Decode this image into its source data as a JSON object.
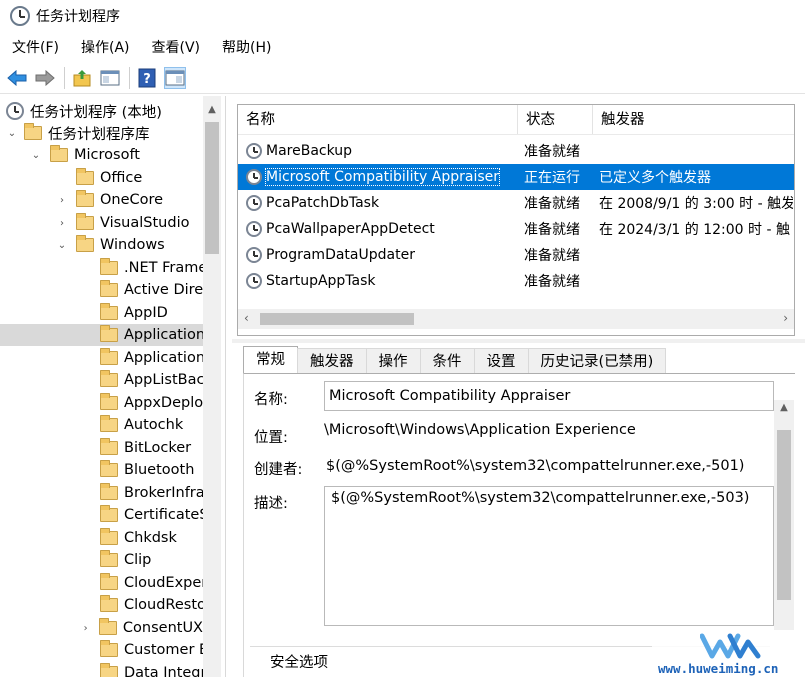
{
  "window": {
    "title": "任务计划程序"
  },
  "menu": [
    "文件(F)",
    "操作(A)",
    "查看(V)",
    "帮助(H)"
  ],
  "toolbar": {
    "icons": [
      "back-arrow-icon",
      "forward-arrow-icon",
      "up-folder-icon",
      "show-hide-tree-icon",
      "help-icon",
      "show-hide-action-pane-icon"
    ]
  },
  "tree": {
    "root": "任务计划程序 (本地)",
    "library": "任务计划程序库",
    "microsoft": "Microsoft",
    "ms_children": [
      "Office",
      "OneCore",
      "VisualStudio",
      "Windows"
    ],
    "windows_children": [
      ".NET Frame",
      "Active Dire",
      "AppID",
      "Application",
      "Application",
      "AppListBac",
      "AppxDeplo",
      "Autochk",
      "BitLocker",
      "Bluetooth",
      "BrokerInfra",
      "CertificateS",
      "Chkdsk",
      "Clip",
      "CloudExper",
      "CloudResto",
      "ConsentUX",
      "Customer E",
      "Data Integr"
    ]
  },
  "tasks": {
    "columns": [
      "名称",
      "状态",
      "触发器"
    ],
    "rows": [
      {
        "name": "MareBackup",
        "status": "准备就绪",
        "trigger": ""
      },
      {
        "name": "Microsoft Compatibility Appraiser",
        "status": "正在运行",
        "trigger": "已定义多个触发器"
      },
      {
        "name": "PcaPatchDbTask",
        "status": "准备就绪",
        "trigger": "在 2008/9/1 的 3:00 时 - 触发"
      },
      {
        "name": "PcaWallpaperAppDetect",
        "status": "准备就绪",
        "trigger": "在 2024/3/1 的 12:00 时 - 触"
      },
      {
        "name": "ProgramDataUpdater",
        "status": "准备就绪",
        "trigger": ""
      },
      {
        "name": "StartupAppTask",
        "status": "准备就绪",
        "trigger": ""
      }
    ]
  },
  "details": {
    "tabs": [
      "常规",
      "触发器",
      "操作",
      "条件",
      "设置",
      "历史记录(已禁用)"
    ],
    "name_label": "名称:",
    "name_value": "Microsoft Compatibility Appraiser",
    "location_label": "位置:",
    "location_value": "\\Microsoft\\Windows\\Application Experience",
    "author_label": "创建者:",
    "author_value": "$(@%SystemRoot%\\system32\\compattelrunner.exe,-501)",
    "desc_label": "描述:",
    "desc_value": "$(@%SystemRoot%\\system32\\compattelrunner.exe,-503)",
    "security_label": "安全选项"
  },
  "watermark": {
    "text": "www.huweiming.cn"
  },
  "colors": {
    "selection": "#0078d7",
    "watermark": "#1e63b8"
  }
}
